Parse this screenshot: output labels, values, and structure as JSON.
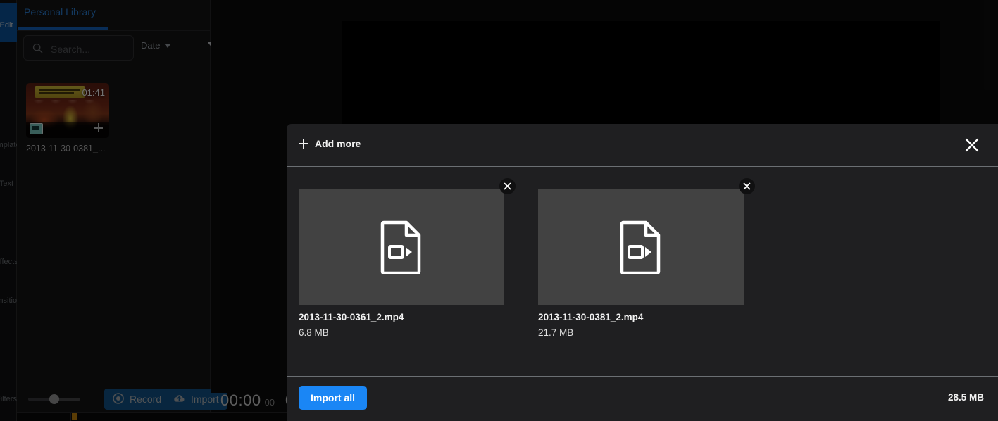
{
  "rail": {
    "active_label": "Edit",
    "items": [
      {
        "label": "Templates"
      },
      {
        "label": "Text"
      },
      {
        "label": "Effects"
      },
      {
        "label": "Transitions"
      },
      {
        "label": "Filters"
      }
    ]
  },
  "library": {
    "tab_label": "Personal Library",
    "search": {
      "placeholder": "Search...",
      "value": "",
      "icon": "search-icon"
    },
    "sort": {
      "label": "Date",
      "icon": "chevron-down-icon"
    },
    "filter": {
      "icon": "filter-icon"
    },
    "media": [
      {
        "name": "2013-11-30-0381_...",
        "duration": "01:41",
        "add_icon": "plus-icon",
        "type_badge": "video-badge-icon"
      }
    ],
    "zoom_slider": {
      "value": 50
    },
    "record_button": {
      "label": "Record",
      "icon": "record-icon"
    },
    "import_button": {
      "label": "Import",
      "icon": "cloud-upload-icon"
    }
  },
  "player": {
    "timecode": "00:00",
    "frames": "00",
    "separator": "0"
  },
  "modal": {
    "add_more_label": "Add more",
    "add_more_icon": "plus-icon",
    "close_icon": "close-icon",
    "files": [
      {
        "name": "2013-11-30-0361_2.mp4",
        "size": "6.8 MB",
        "icon": "video-file-icon",
        "remove_icon": "close-icon"
      },
      {
        "name": "2013-11-30-0381_2.mp4",
        "size": "21.7 MB",
        "icon": "video-file-icon",
        "remove_icon": "close-icon"
      }
    ],
    "import_all_label": "Import all",
    "total_size": "28.5 MB"
  },
  "colors": {
    "accent_blue": "#1a86f5",
    "tab_blue": "#2b7fd4",
    "button_blue": "#12558c",
    "card_gray": "#424242"
  }
}
